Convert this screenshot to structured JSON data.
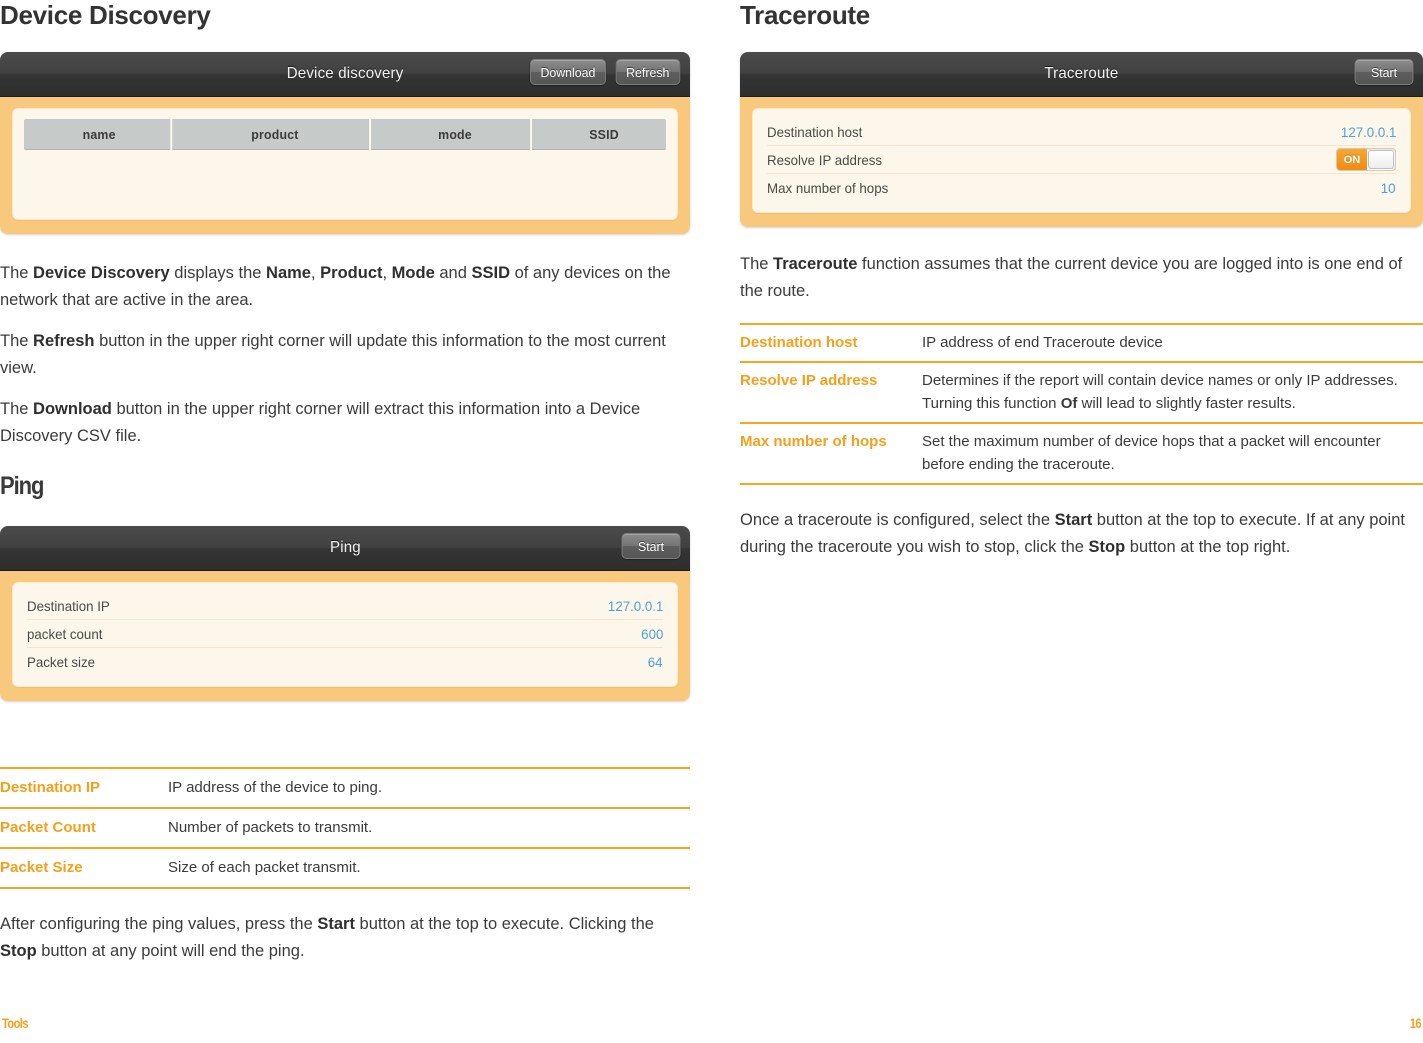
{
  "left": {
    "heading": "Device Discovery",
    "discovery_widget": {
      "title": "Device discovery",
      "download_label": "Download",
      "refresh_label": "Refresh",
      "columns": [
        "name",
        "product",
        "mode",
        "SSID"
      ]
    },
    "paragraphs": [
      {
        "parts": [
          {
            "t": "The ",
            "b": false
          },
          {
            "t": "Device Discovery",
            "b": true
          },
          {
            "t": " displays the ",
            "b": false
          },
          {
            "t": "Name",
            "b": true
          },
          {
            "t": ", ",
            "b": false
          },
          {
            "t": "Product",
            "b": true
          },
          {
            "t": ", ",
            "b": false
          },
          {
            "t": "Mode",
            "b": true
          },
          {
            "t": " and ",
            "b": false
          },
          {
            "t": "SSID",
            "b": true
          },
          {
            "t": " of any devices on the network that are active in the area.",
            "b": false
          }
        ]
      },
      {
        "parts": [
          {
            "t": "The ",
            "b": false
          },
          {
            "t": "Refresh",
            "b": true
          },
          {
            "t": " button in the upper right corner will update this information to the most current view.",
            "b": false
          }
        ]
      },
      {
        "parts": [
          {
            "t": "The ",
            "b": false
          },
          {
            "t": "Download",
            "b": true
          },
          {
            "t": " button in the upper right corner will extract this information into a Device Discovery CSV file.",
            "b": false
          }
        ]
      }
    ],
    "ping_heading": "Ping",
    "ping_widget": {
      "title": "Ping",
      "start_label": "Start",
      "rows": [
        {
          "label": "Destination IP",
          "value": "127.0.0.1"
        },
        {
          "label": "packet count",
          "value": "600"
        },
        {
          "label": "Packet size",
          "value": "64"
        }
      ]
    },
    "ping_definitions": [
      {
        "term": "Destination IP",
        "desc": "IP address of the device to ping."
      },
      {
        "term": "Packet Count",
        "desc": "Number of packets to transmit."
      },
      {
        "term": "Packet Size",
        "desc": "Size of each packet transmit."
      }
    ],
    "closing_paragraph": {
      "parts": [
        {
          "t": "After configuring the ping values, press the ",
          "b": false
        },
        {
          "t": "Start",
          "b": true
        },
        {
          "t": " button at the top to execute. Clicking the ",
          "b": false
        },
        {
          "t": "Stop",
          "b": true
        },
        {
          "t": " button at any point will end the ping.",
          "b": false
        }
      ]
    }
  },
  "right": {
    "heading": "Traceroute",
    "traceroute_widget": {
      "title": "Traceroute",
      "start_label": "Start",
      "rows": [
        {
          "label": "Destination host",
          "value": "127.0.0.1",
          "type": "text"
        },
        {
          "label": "Resolve IP address",
          "value": "ON",
          "type": "toggle"
        },
        {
          "label": "Max number of hops",
          "value": "10",
          "type": "text"
        }
      ]
    },
    "intro_paragraph": {
      "parts": [
        {
          "t": "The ",
          "b": false
        },
        {
          "t": "Traceroute",
          "b": true
        },
        {
          "t": " function assumes that the current device you are logged into is one end of the route.",
          "b": false
        }
      ]
    },
    "definitions": [
      {
        "term": "Destination host",
        "parts": [
          {
            "t": "IP address of end Traceroute device",
            "b": false
          }
        ]
      },
      {
        "term": "Resolve IP address",
        "parts": [
          {
            "t": "Determines if the report will contain device names or only IP addresses. Turning this function ",
            "b": false
          },
          {
            "t": "Of",
            "b": true
          },
          {
            "t": " will lead to slightly faster results.",
            "b": false
          }
        ]
      },
      {
        "term": "Max number of hops",
        "parts": [
          {
            "t": "Set the maximum number of device hops that a packet will encounter before ending the traceroute.",
            "b": false
          }
        ]
      }
    ],
    "closing_paragraph": {
      "parts": [
        {
          "t": "Once a traceroute is configured, select the ",
          "b": false
        },
        {
          "t": "Start",
          "b": true
        },
        {
          "t": " button at the top to execute. If at any point during the traceroute you wish to stop, click the ",
          "b": false
        },
        {
          "t": "Stop",
          "b": true
        },
        {
          "t": " button at the top right.",
          "b": false
        }
      ]
    }
  },
  "footer": {
    "label": "Tools",
    "page": "16"
  },
  "colors": {
    "accent_orange": "#f5a01c",
    "panel_border": "#f8c97d",
    "panel_inner": "#fdf6ea",
    "value_blue": "#4fa2d4",
    "bar_dark": "#3a3a3a"
  }
}
